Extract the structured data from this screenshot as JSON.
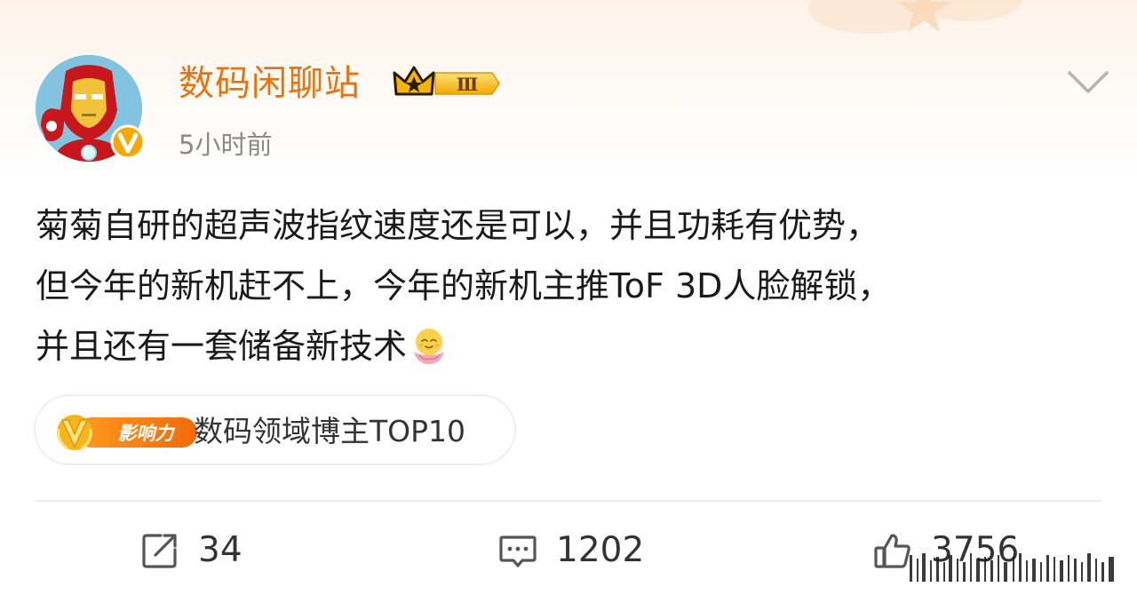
{
  "post": {
    "author": "数码闲聊站",
    "level_badge": "Ⅲ",
    "time": "5小时前",
    "text_lines": [
      "菊菊自研的超声波指纹速度还是可以，并且功耗有优势，",
      "但今年的新机赶不上，今年的新机主推ToF 3D人脸解锁，",
      "并且还有一套储备新技术"
    ],
    "emoji": "smiling-lotus-emoji"
  },
  "influence": {
    "badge_label": "影响力",
    "text": "数码领域博主TOP10"
  },
  "actions": {
    "repost_count": "34",
    "comment_count": "1202",
    "like_count": "3756"
  },
  "colors": {
    "author": "#e8730c",
    "accent_orange": "#f7941d",
    "badge_gold": "#f5b400",
    "text": "#1a1a1a",
    "muted": "#8a8a8a"
  },
  "icons": [
    "chevron-down-icon",
    "repost-icon",
    "comment-icon",
    "like-icon",
    "verified-v-icon",
    "crown-icon"
  ]
}
